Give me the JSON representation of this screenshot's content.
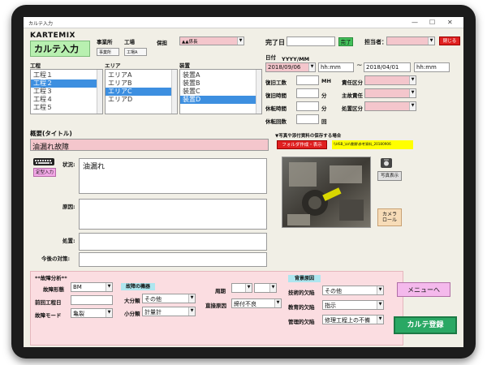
{
  "window": {
    "title": "カルテ入力",
    "controls": [
      "—",
      "☐",
      "✕"
    ]
  },
  "logo": {
    "brand": "KARTEMIX",
    "title": "カルテ入力"
  },
  "header": {
    "office_label": "事業所",
    "workplace_label": "工場",
    "office_value": "事業所",
    "workplace_value": "工場A",
    "owner_label": "保担",
    "owner_value": "▲▲係長",
    "completion_label": "完了日",
    "completion_button": "完了",
    "person_label": "担当者：",
    "close_button": "閉じる"
  },
  "process": {
    "label": "工程",
    "items": [
      "工程１",
      "工程２",
      "工程３",
      "工程４",
      "工程５"
    ],
    "selected_index": 1
  },
  "area": {
    "label": "エリア",
    "items": [
      "エリアA",
      "エリアB",
      "エリアC",
      "エリアD"
    ],
    "selected_index": 2
  },
  "device": {
    "label": "装置",
    "items": [
      "装置A",
      "装置B",
      "装置C",
      "装置D"
    ],
    "selected_index": 3
  },
  "datetime": {
    "label": "日付",
    "format": "YYYY/MM",
    "start_date": "2018/09/06",
    "start_time": "hh:mm",
    "tilde": "~",
    "end_date": "2018/04/01",
    "end_time": "hh:mm"
  },
  "work": {
    "rows": [
      {
        "label": "復旧工数",
        "unit": "MH"
      },
      {
        "label": "復旧時間",
        "unit": "分"
      },
      {
        "label": "休転時間",
        "unit": "分"
      },
      {
        "label": "休転回数",
        "unit": "回"
      }
    ],
    "right_rows": [
      {
        "label": "責任区分"
      },
      {
        "label": "主故責任"
      },
      {
        "label": "処置区分"
      }
    ]
  },
  "summary": {
    "label": "概要(タイトル)",
    "value": "油漏れ故障"
  },
  "attach": {
    "label": "▼写真や添付資料の保存する場合",
    "folder_button": "フォルダ作成・表示",
    "path_text": "\\\\HSB_\\zz\\書類\\参考資料_20180906"
  },
  "keyboard": {
    "button": "定型入力"
  },
  "details": {
    "status_label": "状況:",
    "status_value": "油漏れ",
    "cause_label": "原因:",
    "measure_label": "処置:",
    "future_label": "今後の対策:"
  },
  "photo": {
    "camera_icon": "camera-icon",
    "show_button": "写真表示",
    "roll_button_line1": "カメラ",
    "roll_button_line2": "ロール"
  },
  "analysis": {
    "header": "**故障分析**",
    "phenomenon_label": "故障形態",
    "phenomenon_value": "BM",
    "pre_process_label": "前回工程日",
    "failure_mode_label": "故障モード",
    "failure_mode_value": "亀裂",
    "equipment_tag": "故障の機器",
    "major_label": "大分類",
    "major_value": "その他",
    "minor_label": "小分類",
    "minor_value": "計量計",
    "cycle_label": "周期",
    "direct_label": "直接原因",
    "direct_value": "締付不良",
    "bg_tag": "背景原因",
    "tech_label": "技術的欠陥",
    "tech_value": "その他",
    "edu_label": "教育的欠陥",
    "edu_value": "指示",
    "mgmt_label": "管理的欠陥",
    "mgmt_value": "修理工程上の不備"
  },
  "actions": {
    "menu_button": "メニューへ",
    "register_button": "カルテ登録"
  },
  "colors": {
    "pink": "#f4c6cc",
    "green": "#2aa864",
    "red": "#e02020",
    "yellow": "#ffff00",
    "cyan": "#aee6ef",
    "select": "#3d8fe0"
  }
}
